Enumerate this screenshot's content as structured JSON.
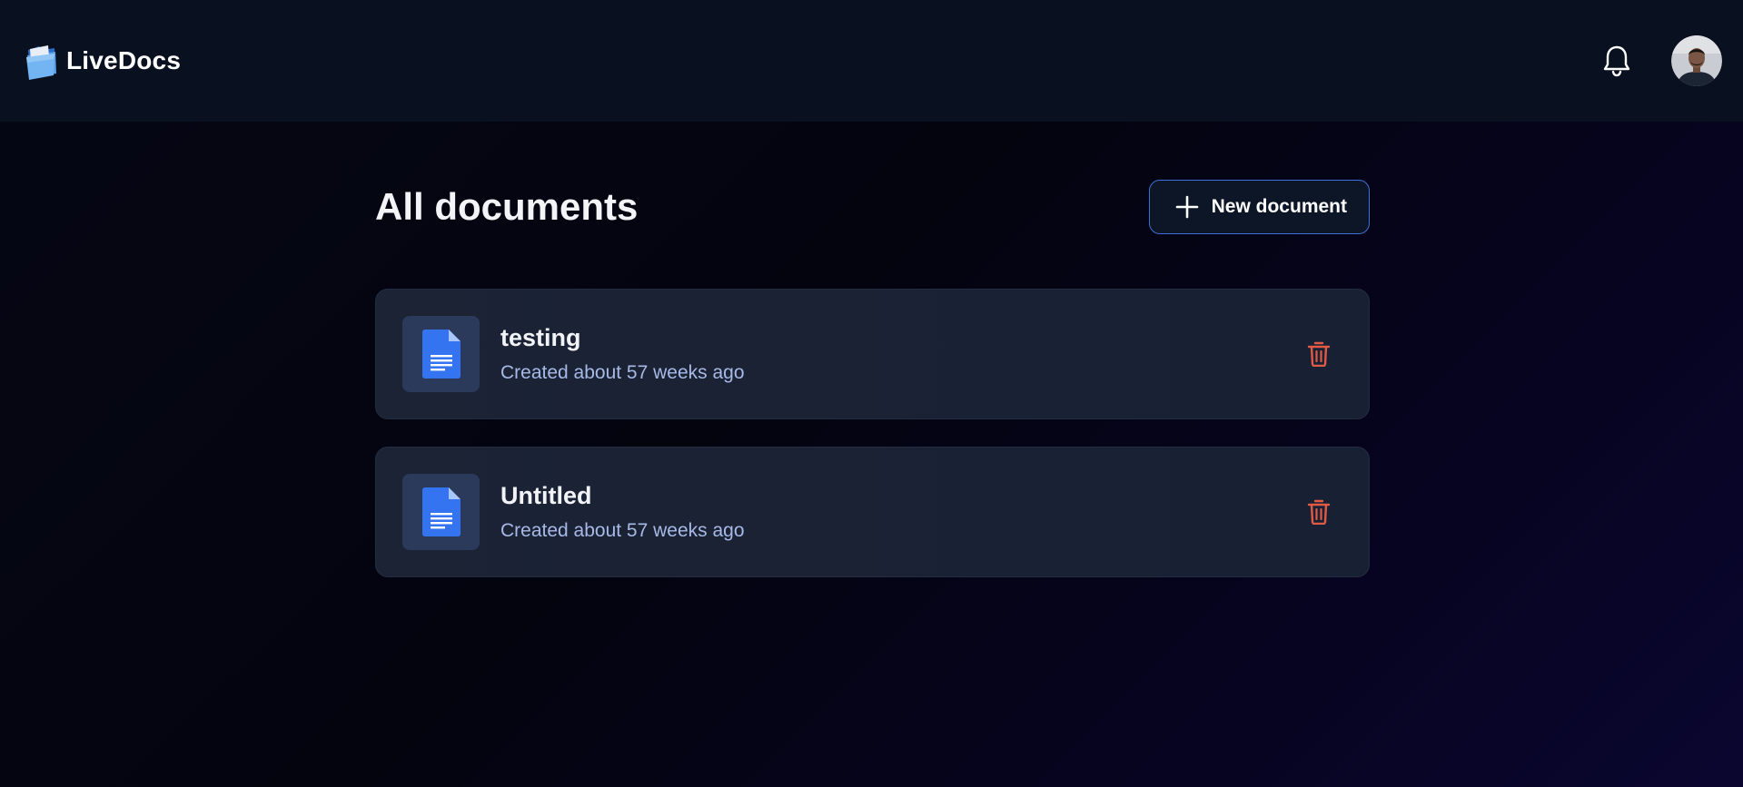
{
  "header": {
    "brand_name": "LiveDocs",
    "logo_icon": "folder-icon",
    "notification_icon": "bell-icon",
    "avatar_icon": "avatar"
  },
  "main": {
    "title": "All documents",
    "new_document_label": "New document",
    "documents": [
      {
        "title": "testing",
        "subtitle": "Created about 57 weeks ago"
      },
      {
        "title": "Untitled",
        "subtitle": "Created about 57 weeks ago"
      }
    ]
  },
  "colors": {
    "background": "#05060f",
    "header": "#09101f",
    "card": "#1b2335",
    "accent_border": "#3e70d8",
    "doc_icon_blue": "#3574f0",
    "subtitle_text": "#a7b9e6",
    "delete_icon": "#e05b45"
  }
}
